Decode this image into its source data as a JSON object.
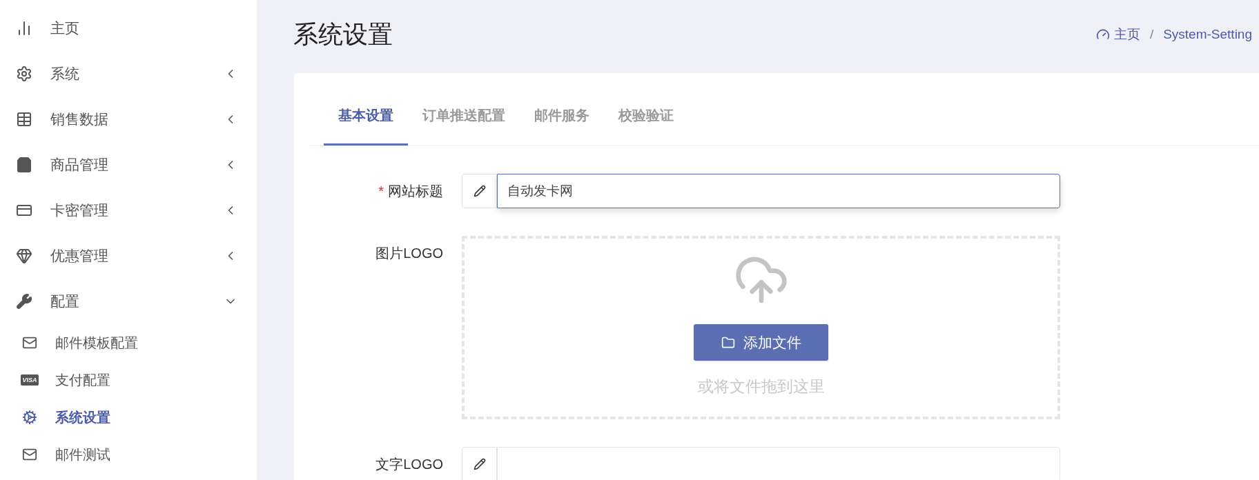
{
  "sidebar": {
    "items": [
      {
        "label": "主页"
      },
      {
        "label": "系统",
        "expanded": false
      },
      {
        "label": "销售数据",
        "expanded": false
      },
      {
        "label": "商品管理",
        "expanded": false
      },
      {
        "label": "卡密管理",
        "expanded": false
      },
      {
        "label": "优惠管理",
        "expanded": false
      },
      {
        "label": "配置",
        "expanded": true,
        "children": [
          {
            "label": "邮件模板配置",
            "selected": false
          },
          {
            "label": "支付配置",
            "icon_text": "VISA",
            "selected": false
          },
          {
            "label": "系统设置",
            "selected": true
          },
          {
            "label": "邮件测试",
            "selected": false
          }
        ]
      }
    ]
  },
  "page_title": "系统设置",
  "breadcrumb": [
    "主页",
    "/",
    "System-Setting"
  ],
  "tabs": [
    {
      "label": "基本设置",
      "selected": true
    },
    {
      "label": "订单推送配置",
      "selected": false
    },
    {
      "label": "邮件服务",
      "selected": false
    },
    {
      "label": "校验验证",
      "selected": false
    }
  ],
  "form": {
    "fields": [
      {
        "kind": "text",
        "label": "网站标题",
        "required_mark": "*",
        "value": "自动发卡网",
        "focused": true
      },
      {
        "kind": "upload",
        "label": "图片LOGO",
        "button": "添加文件",
        "hint": "或将文件拖到这里"
      },
      {
        "kind": "text",
        "label": "文字LOGO",
        "focused": false
      }
    ]
  }
}
